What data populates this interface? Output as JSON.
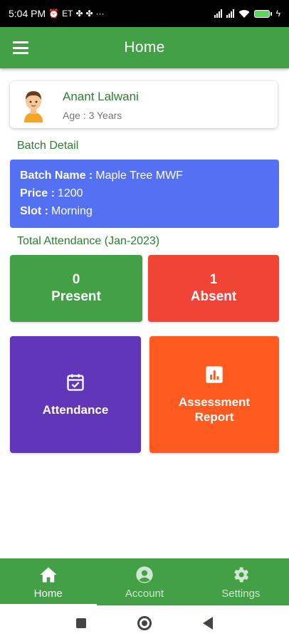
{
  "status_bar": {
    "time": "5:04 PM",
    "left_icons": [
      "alarm-icon",
      "et-icon",
      "pinwheel-icon",
      "pinwheel-icon",
      "more-icon"
    ],
    "et_label": "ET",
    "more_label": "···",
    "battery_level": "88"
  },
  "app_bar": {
    "title": "Home"
  },
  "profile": {
    "name": "Anant Lalwani",
    "age": "Age : 3 Years"
  },
  "batch": {
    "section_title": "Batch Detail",
    "rows": [
      {
        "key": "Batch Name :",
        "value": "Maple Tree MWF"
      },
      {
        "key": "Price :",
        "value": "1200"
      },
      {
        "key": "Slot :",
        "value": "Morning"
      }
    ],
    "color": "#5470f3"
  },
  "attendance": {
    "section_title": "Total Attendance (Jan-2023)",
    "present_count": "0",
    "present_label": "Present",
    "absent_count": "1",
    "absent_label": "Absent"
  },
  "actions": {
    "attendance_label": "Attendance",
    "report_label_line1": "Assessment",
    "report_label_line2": "Report"
  },
  "bottom_nav": {
    "items": [
      {
        "label": "Home",
        "icon": "home-icon",
        "active": true
      },
      {
        "label": "Account",
        "icon": "account-icon",
        "active": false
      },
      {
        "label": "Settings",
        "icon": "settings-icon",
        "active": false
      }
    ]
  },
  "colors": {
    "primary_green": "#43a047",
    "absent_red": "#ef4436",
    "attendance_purple": "#6236b8",
    "report_orange": "#ff5a1f"
  }
}
